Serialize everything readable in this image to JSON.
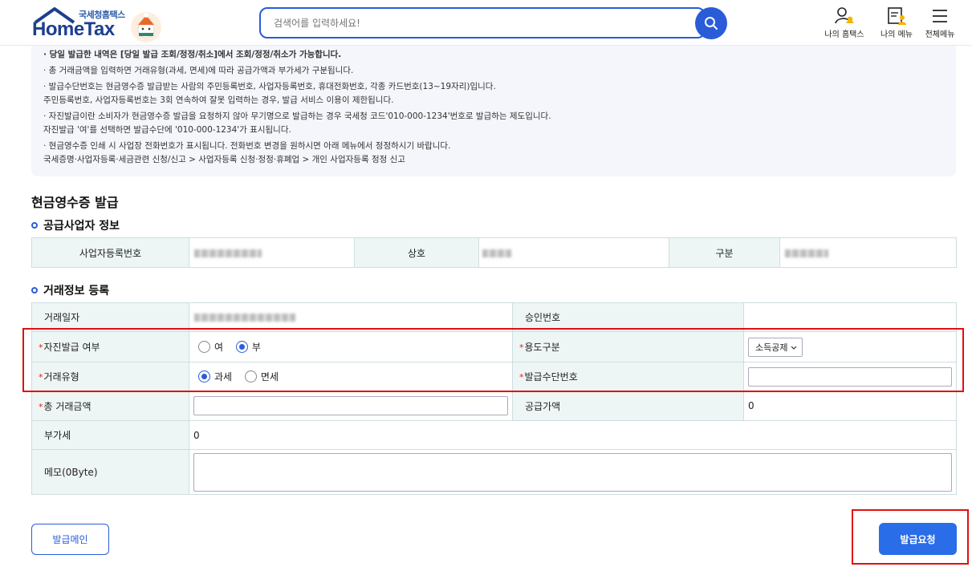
{
  "header": {
    "logo_sub": "국세청홈택스",
    "logo_main": "HomeTax",
    "search_placeholder": "검색어를 입력하세요!",
    "nav": [
      {
        "label": "나의 홈택스",
        "icon": "user-bell-icon"
      },
      {
        "label": "나의 메뉴",
        "icon": "document-user-icon"
      },
      {
        "label": "전체메뉴",
        "icon": "hamburger-menu-icon"
      }
    ]
  },
  "notice": {
    "lines": [
      "· 당일 발급한 내역은 [당일 발급 조회/정정/취소]에서 조회/정정/취소가 가능합니다.",
      "· 총 거래금액을 입력하면 거래유형(과세, 면세)에 따라 공급가액과 부가세가 구분됩니다.",
      "· 발급수단번호는 현금영수증 발급받는 사람의  주민등록번호, 사업자등록번호, 휴대전화번호, 각종 카드번호(13~19자리)입니다.",
      "  주민등록번호, 사업자등록번호는 3회 연속하여 잘못 입력하는 경우, 발급 서비스 이용이 제한됩니다.",
      "· 자진발급이란 소비자가 현금영수증 발급을 요청하지 않아 무기명으로 발급하는 경우 국세청 코드'010-000-1234'번호로 발급하는 제도입니다.",
      "  자진발급 '여'를 선택하면 발급수단에 '010-000-1234'가 표시됩니다.",
      "· 현금영수증 인쇄 시 사업장 전화번호가 표시됩니다. 전화번호 변경을 원하시면 아래 메뉴에서 정정하시기 바랍니다.",
      "  국세증명·사업자등록·세금관련 신청/신고 > 사업자등록 신청·정정·휴폐업 > 개인 사업자등록 정정 신고"
    ]
  },
  "page_title": "현금영수증 발급",
  "supplier": {
    "title": "공급사업자 정보",
    "biz_no_label": "사업자등록번호",
    "name_label": "상호",
    "type_label": "구분"
  },
  "trade": {
    "title": "거래정보 등록",
    "date_label": "거래일자",
    "approval_label": "승인번호",
    "self_issue_label": "자진발급 여부",
    "self_issue_yes": "여",
    "self_issue_no": "부",
    "usage_label": "용도구분",
    "usage_value": "소득공제",
    "trade_type_label": "거래유형",
    "taxable": "과세",
    "exempt": "면세",
    "issue_no_label": "발급수단번호",
    "total_label": "총 거래금액",
    "supply_label": "공급가액",
    "supply_value": "0",
    "vat_label": "부가세",
    "vat_value": "0",
    "memo_label": "메모(0Byte)"
  },
  "buttons": {
    "main": "발급메인",
    "issue": "발급요청"
  },
  "colors": {
    "brand": "#2a5cd8",
    "highlight": "#e01010",
    "table_header": "#eef6f5"
  }
}
